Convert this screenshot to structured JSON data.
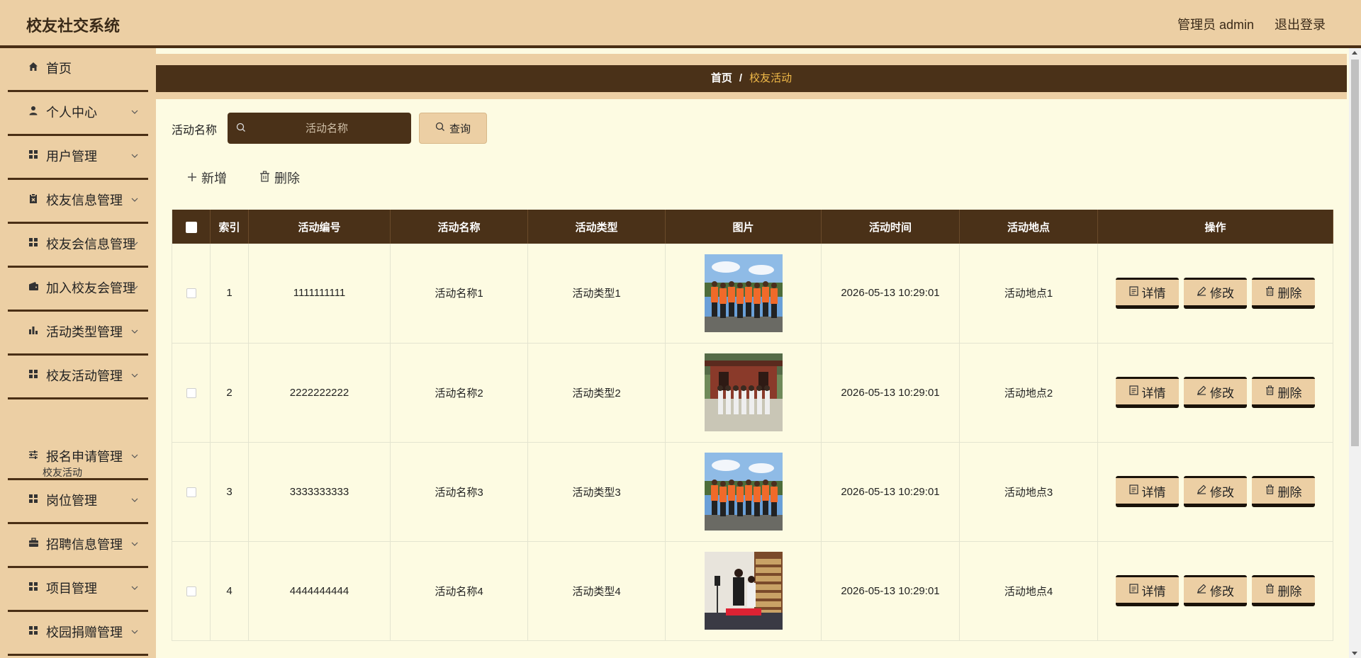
{
  "app": {
    "title": "校友社交系统",
    "user_label": "管理员 admin",
    "logout_label": "退出登录"
  },
  "colors": {
    "accent": "#eccfa4",
    "dark": "#4a3118",
    "background": "#fdfbe2",
    "breadcrumb_current": "#f0b948"
  },
  "sidebar": {
    "items": [
      {
        "label": "首页",
        "icon": "home-icon",
        "has_arrow": false
      },
      {
        "label": "个人中心",
        "icon": "user-icon",
        "has_arrow": true
      },
      {
        "label": "用户管理",
        "icon": "grid-icon",
        "has_arrow": true
      },
      {
        "label": "校友信息管理",
        "icon": "clipboard-icon",
        "has_arrow": true
      },
      {
        "label": "校友会信息管理",
        "icon": "grid-icon",
        "has_arrow": true
      },
      {
        "label": "加入校友会管理",
        "icon": "wallet-icon",
        "has_arrow": true
      },
      {
        "label": "活动类型管理",
        "icon": "bar-chart-icon",
        "has_arrow": true
      },
      {
        "label": "校友活动管理",
        "icon": "grid-icon",
        "has_arrow": true
      },
      {
        "label": "报名申请管理",
        "icon": "sliders-icon",
        "has_arrow": true
      },
      {
        "label": "岗位管理",
        "icon": "grid-icon",
        "has_arrow": true
      },
      {
        "label": "招聘信息管理",
        "icon": "briefcase-icon",
        "has_arrow": true
      },
      {
        "label": "项目管理",
        "icon": "grid-icon",
        "has_arrow": true
      },
      {
        "label": "校园捐赠管理",
        "icon": "grid-icon",
        "has_arrow": true
      }
    ],
    "submenu_label": "校友活动"
  },
  "breadcrumb": {
    "home": "首页",
    "separator": "/",
    "current": "校友活动"
  },
  "search": {
    "label": "活动名称",
    "placeholder": "活动名称",
    "value": "",
    "query_label": "查询"
  },
  "toolbar": {
    "add_label": "新增",
    "delete_label": "删除"
  },
  "table": {
    "columns": [
      "索引",
      "活动编号",
      "活动名称",
      "活动类型",
      "图片",
      "活动时间",
      "活动地点",
      "操作"
    ],
    "rows": [
      {
        "index": "1",
        "code": "1111111111",
        "name": "活动名称1",
        "type": "活动类型1",
        "image": "group-photo-orange-shirts",
        "time": "2026-05-13 10:29:01",
        "place": "活动地点1"
      },
      {
        "index": "2",
        "code": "2222222222",
        "name": "活动名称2",
        "type": "活动类型2",
        "image": "group-photo-temple",
        "time": "2026-05-13 10:29:01",
        "place": "活动地点2"
      },
      {
        "index": "3",
        "code": "3333333333",
        "name": "活动名称3",
        "type": "活动类型3",
        "image": "group-photo-orange-shirts",
        "time": "2026-05-13 10:29:01",
        "place": "活动地点3"
      },
      {
        "index": "4",
        "code": "4444444444",
        "name": "活动名称4",
        "type": "活动类型4",
        "image": "meeting-room-photo",
        "time": "2026-05-13 10:29:01",
        "place": "活动地点4"
      }
    ],
    "actions": {
      "detail_label": "详情",
      "edit_label": "修改",
      "delete_label": "删除"
    }
  }
}
